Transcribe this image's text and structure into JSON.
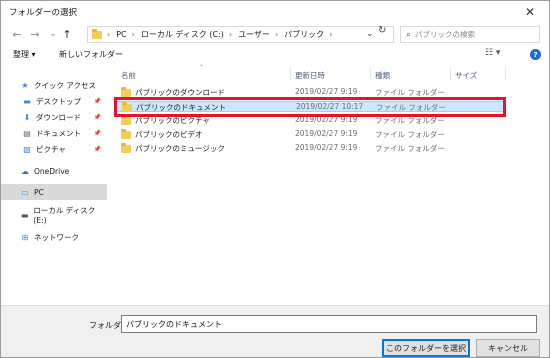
{
  "window": {
    "title": "フォルダーの選択",
    "close_glyph": "✕"
  },
  "nav": {
    "back": "←",
    "forward": "→",
    "dropdown": "⌄",
    "up": "↑"
  },
  "address": {
    "crumbs": [
      "PC",
      "ローカル ディスク (C:)",
      "ユーザー",
      "パブリック"
    ],
    "separator": "›",
    "dropdown": "⌄",
    "refresh": "↻"
  },
  "search": {
    "placeholder": "パブリックの検索",
    "icon": "⌕"
  },
  "toolbar": {
    "organize": "整理 ▾",
    "new_folder": "新しいフォルダー",
    "view": "☷ ▾",
    "help": "?"
  },
  "navpane": {
    "items": [
      {
        "label": "クイック アクセス",
        "icon": "★",
        "color": "#3a8ad8",
        "pinned": false,
        "selected": false
      },
      {
        "label": "デスクトップ",
        "icon": "▬",
        "color": "#3a8ad8",
        "pinned": true,
        "selected": false
      },
      {
        "label": "ダウンロード",
        "icon": "⬇",
        "color": "#3a8ad8",
        "pinned": true,
        "selected": false
      },
      {
        "label": "ドキュメント",
        "icon": "▤",
        "color": "#6b6b6b",
        "pinned": true,
        "selected": false
      },
      {
        "label": "ピクチャ",
        "icon": "▨",
        "color": "#3a8ad8",
        "pinned": true,
        "selected": false
      },
      {
        "label": "OneDrive",
        "icon": "☁",
        "color": "#2b73c9",
        "pinned": false,
        "selected": false
      },
      {
        "label": "PC",
        "icon": "▭",
        "color": "#3a8ad8",
        "pinned": false,
        "selected": true
      },
      {
        "label": "ローカル ディスク (E:)",
        "icon": "▬",
        "color": "#555555",
        "pinned": false,
        "selected": false
      },
      {
        "label": "ネットワーク",
        "icon": "⊞",
        "color": "#3a8ad8",
        "pinned": false,
        "selected": false
      }
    ],
    "pin_glyph": "📌"
  },
  "columns": {
    "name": "名前",
    "date": "更新日時",
    "type": "種類",
    "size": "サイズ",
    "sort": "⌃"
  },
  "files": [
    {
      "name": "パブリックのダウンロード",
      "date": "2019/02/27 9:19",
      "type": "ファイル フォルダー",
      "selected": false
    },
    {
      "name": "パブリックのドキュメント",
      "date": "2019/02/27 10:17",
      "type": "ファイル フォルダー",
      "selected": true
    },
    {
      "name": "パブリックのピクチャ",
      "date": "2019/02/27 9:19",
      "type": "ファイル フォルダー",
      "selected": false
    },
    {
      "name": "パブリックのビデオ",
      "date": "2019/02/27 9:19",
      "type": "ファイル フォルダー",
      "selected": false
    },
    {
      "name": "パブリックのミュージック",
      "date": "2019/02/27 9:19",
      "type": "ファイル フォルダー",
      "selected": false
    }
  ],
  "footer": {
    "folder_label": "フォルダー:",
    "folder_value": "パブリックのドキュメント",
    "select_button": "このフォルダーを選択",
    "cancel_button": "キャンセル"
  },
  "colors": {
    "highlight": "#e0142b",
    "selection": "#cce8ff",
    "accent": "#0078d7"
  }
}
